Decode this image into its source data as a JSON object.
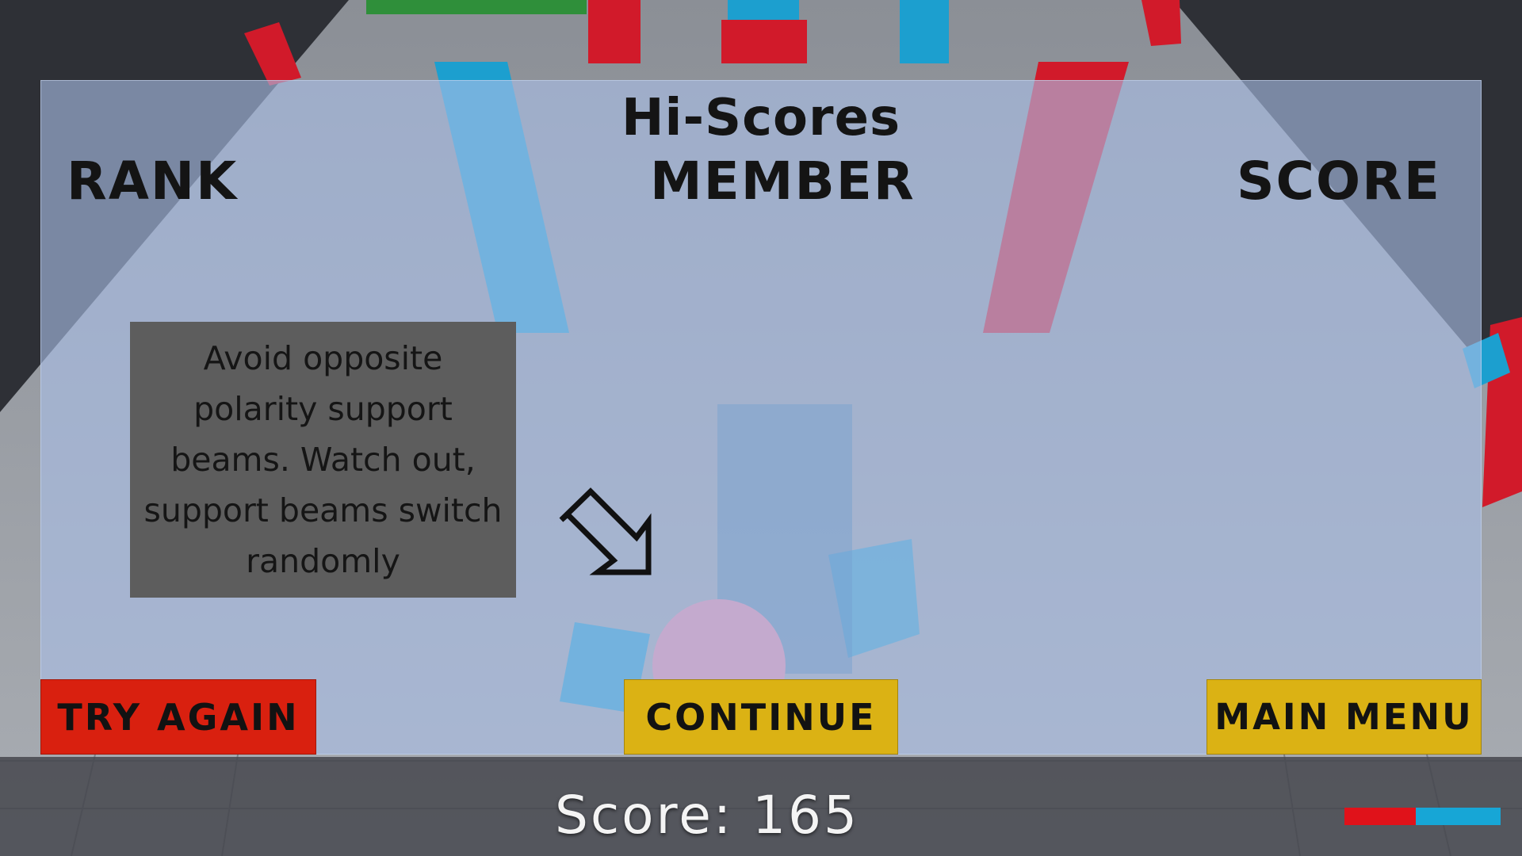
{
  "hiscores": {
    "title": "Hi-Scores",
    "columns": {
      "rank": "RANK",
      "member": "MEMBER",
      "score": "SCORE"
    }
  },
  "tip": {
    "text": "Avoid opposite polarity support beams. Watch out, support beams switch randomly"
  },
  "buttons": {
    "try_again": "TRY AGAIN",
    "continue": "CONTINUE",
    "main_menu": "MAIN MENU"
  },
  "hud": {
    "score_label": "Score: 165",
    "score_value": 165
  },
  "colors": {
    "red_polarity": "#e0121a",
    "blue_polarity": "#17a6d6",
    "try_again_bg": "#d9200f",
    "continue_bg": "#dbb214",
    "player_ball": "#f08aa5"
  },
  "icons": {
    "pointer": "arrow-pointer-icon"
  }
}
